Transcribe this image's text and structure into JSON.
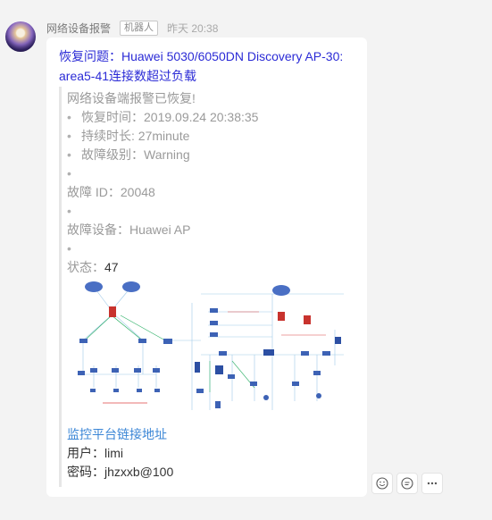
{
  "message": {
    "sender": "网络设备报警",
    "badge": "机器人",
    "time": "昨天 20:38",
    "title": "恢复问题：Huawei 5030/6050DN Discovery AP-30: area5-41连接数超过负载",
    "quote": {
      "heading": "网络设备端报警已恢复!",
      "recovery_time": "恢复时间：2019.09.24 20:38:35",
      "duration": "持续时长: 27minute",
      "severity": "故障级别：Warning",
      "fault_id": "故障 ID：20048",
      "device": "故障设备：Huawei AP",
      "status_label": "状态：",
      "status_value": "47",
      "link_text": "监控平台链接地址",
      "user": "用户：limi",
      "password": "密码：jhzxxb@100"
    }
  },
  "actions": [
    {
      "icon": "smile-icon",
      "label": "表情"
    },
    {
      "icon": "reply-icon",
      "label": "回复"
    },
    {
      "icon": "more-icon",
      "label": "更多"
    }
  ],
  "colors": {
    "background": "#f3f3f3",
    "title": "#2b2bd6",
    "link": "#3b86d6",
    "muted": "#9a9a9a"
  }
}
